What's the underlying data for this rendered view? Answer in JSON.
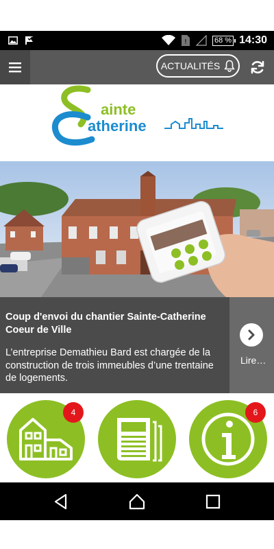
{
  "status_bar": {
    "battery": "68 %",
    "time": "14:30",
    "icons": [
      "image-icon",
      "check-flag-icon",
      "wifi-icon",
      "sim-icon",
      "signal-icon",
      "battery-icon"
    ]
  },
  "app_bar": {
    "news_label": "ACTUALITÉS",
    "icons": [
      "menu-icon",
      "bell-icon",
      "refresh-icon"
    ]
  },
  "logo": {
    "line1": "ainte",
    "line2": "atherine",
    "colors": {
      "green": "#8dbf24",
      "blue": "#1c8ccf"
    }
  },
  "article": {
    "title": "Coup d'envoi du chantier Sainte-Catherine Coeur de Ville",
    "summary": "L’entreprise Demathieu Bard est chargée de la construction de trois immeubles d’une trentaine de logements.",
    "read_more": "Lire…"
  },
  "tiles": [
    {
      "name": "housing",
      "icon": "house-icon",
      "badge": "4"
    },
    {
      "name": "newspaper",
      "icon": "newspaper-icon",
      "badge": ""
    },
    {
      "name": "info",
      "icon": "info-icon",
      "badge": "6"
    }
  ],
  "theme": {
    "accent": "#8dbf24",
    "badge": "#e3171b",
    "appbar": "#595959"
  }
}
